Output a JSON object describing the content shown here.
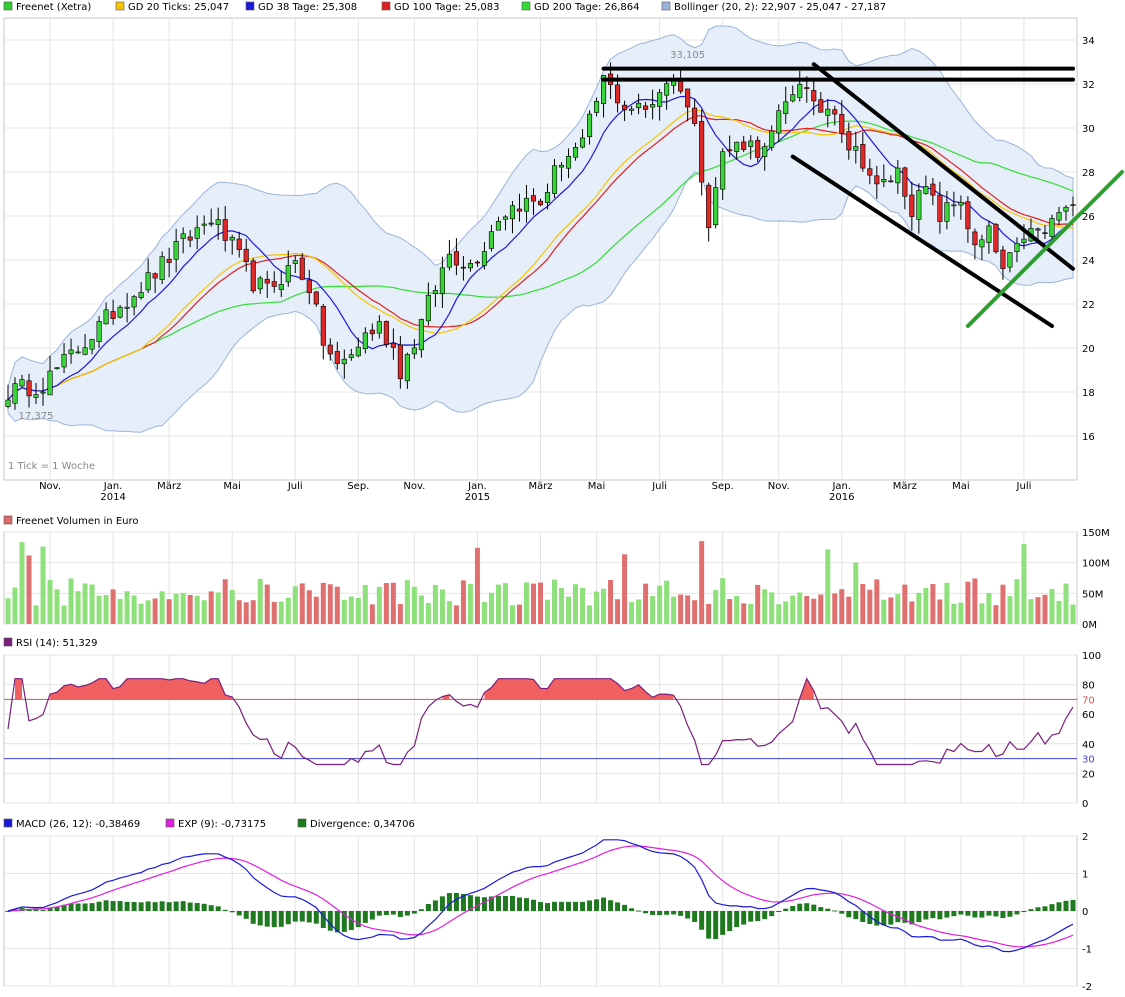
{
  "chart_data": [
    {
      "panel": "price",
      "type": "candlestick",
      "legend": [
        {
          "label": "Freenet (Xetra)",
          "color": "#2ecc2e"
        },
        {
          "label": "GD 20 Ticks: 25,047",
          "color": "#f5c400"
        },
        {
          "label": "GD 38 Tage: 25,308",
          "color": "#1a1adc"
        },
        {
          "label": "GD 100 Tage: 25,083",
          "color": "#e02020"
        },
        {
          "label": "GD 200 Tage: 26,864",
          "color": "#33dd33"
        },
        {
          "label": "Bollinger (20, 2): 22,907 - 25,047 - 27,187",
          "color": "#9ab4dc"
        }
      ],
      "ylim": [
        14,
        35
      ],
      "yticks": [
        "16",
        "18",
        "20",
        "22",
        "24",
        "26",
        "28",
        "30",
        "32",
        "34"
      ],
      "xticks": [
        {
          "label": "Nov.",
          "week": 6
        },
        {
          "label": "Jan.",
          "sub": "2014",
          "week": 15
        },
        {
          "label": "März",
          "week": 23
        },
        {
          "label": "Mai",
          "week": 32
        },
        {
          "label": "Juli",
          "week": 41
        },
        {
          "label": "Sep.",
          "week": 50
        },
        {
          "label": "Nov.",
          "week": 58
        },
        {
          "label": "Jan.",
          "sub": "2015",
          "week": 67
        },
        {
          "label": "März",
          "week": 76
        },
        {
          "label": "Mai",
          "week": 84
        },
        {
          "label": "Juli",
          "week": 93
        },
        {
          "label": "Sep.",
          "week": 102
        },
        {
          "label": "Nov.",
          "week": 110
        },
        {
          "label": "Jan.",
          "sub": "2016",
          "week": 119
        },
        {
          "label": "März",
          "week": 128
        },
        {
          "label": "Mai",
          "week": 136
        },
        {
          "label": "Juli",
          "week": 145
        }
      ],
      "annotations": [
        {
          "text": "33,105",
          "week": 97,
          "value": 33.1
        },
        {
          "text": "17,375",
          "week": 4,
          "value": 17.4
        },
        {
          "text": "1 Tick = 1 Woche"
        }
      ],
      "weeks": 152,
      "close_anchors": [
        [
          0,
          18.0
        ],
        [
          5,
          18.4
        ],
        [
          12,
          20.6
        ],
        [
          16,
          22.0
        ],
        [
          20,
          23.1
        ],
        [
          25,
          24.8
        ],
        [
          29,
          25.9
        ],
        [
          32,
          24.6
        ],
        [
          35,
          23.0
        ],
        [
          37,
          22.6
        ],
        [
          41,
          23.9
        ],
        [
          43,
          22.8
        ],
        [
          45,
          20.3
        ],
        [
          47,
          19.1
        ],
        [
          49,
          19.7
        ],
        [
          51,
          20.6
        ],
        [
          53,
          21.0
        ],
        [
          55,
          20.0
        ],
        [
          56,
          19.0
        ],
        [
          58,
          20.3
        ],
        [
          60,
          22.0
        ],
        [
          63,
          24.3
        ],
        [
          66,
          23.8
        ],
        [
          68,
          24.7
        ],
        [
          70,
          26.0
        ],
        [
          73,
          26.6
        ],
        [
          76,
          26.6
        ],
        [
          79,
          28.6
        ],
        [
          82,
          29.2
        ],
        [
          85,
          32.2
        ],
        [
          88,
          31.0
        ],
        [
          91,
          30.8
        ],
        [
          94,
          32.2
        ],
        [
          96,
          32.0
        ],
        [
          98,
          30.0
        ],
        [
          100,
          25.9
        ],
        [
          102,
          28.8
        ],
        [
          105,
          29.4
        ],
        [
          108,
          28.9
        ],
        [
          110,
          30.4
        ],
        [
          113,
          32.3
        ],
        [
          115,
          30.8
        ],
        [
          118,
          31.0
        ],
        [
          120,
          29.2
        ],
        [
          122,
          28.6
        ],
        [
          124,
          27.2
        ],
        [
          127,
          28.0
        ],
        [
          129,
          26.4
        ],
        [
          131,
          27.2
        ],
        [
          133,
          26.0
        ],
        [
          136,
          26.8
        ],
        [
          138,
          24.4
        ],
        [
          140,
          25.2
        ],
        [
          142,
          23.5
        ],
        [
          144,
          24.4
        ],
        [
          145,
          25.2
        ],
        [
          148,
          25.2
        ],
        [
          150,
          26.2
        ],
        [
          152,
          26.2
        ]
      ],
      "trend_lines": [
        {
          "from": [
            85,
            32.7
          ],
          "to": [
            152,
            32.7
          ],
          "color": "#000000"
        },
        {
          "from": [
            85,
            32.2
          ],
          "to": [
            152,
            32.2
          ],
          "color": "#000000"
        },
        {
          "from": [
            115,
            32.9
          ],
          "to": [
            152,
            23.6
          ],
          "color": "#000000"
        },
        {
          "from": [
            112,
            28.7
          ],
          "to": [
            149,
            21.0
          ],
          "color": "#000000"
        },
        {
          "from": [
            137,
            21.0
          ],
          "to": [
            159,
            28.0
          ],
          "color": "#2ca02c"
        }
      ]
    },
    {
      "panel": "volume",
      "type": "bar",
      "legend": [
        {
          "label": "Freenet Volumen in Euro",
          "color": "#e06a6a"
        }
      ],
      "ylim": [
        0,
        150
      ],
      "yticks": [
        "0M",
        "50M",
        "100M",
        "150M"
      ],
      "colors": {
        "up": "#8ee07a",
        "down": "#e07070"
      }
    },
    {
      "panel": "rsi",
      "type": "line",
      "legend": [
        {
          "label": "RSI (14): 51,329",
          "color": "#7a1f7a"
        }
      ],
      "ylim": [
        0,
        100
      ],
      "yticks": [
        "0",
        "20",
        "40",
        "60",
        "80",
        "100"
      ],
      "levels": [
        {
          "value": 70,
          "label": "70",
          "color": "#e05050"
        },
        {
          "value": 30,
          "label": "30",
          "color": "#4040e0"
        }
      ]
    },
    {
      "panel": "macd",
      "type": "line",
      "legend": [
        {
          "label": "MACD (26, 12): -0,38469",
          "color": "#1a1adc"
        },
        {
          "label": "EXP (9): -0,73175",
          "color": "#e020e0"
        },
        {
          "label": "Divergence: 0,34706",
          "color": "#1a7a1a"
        }
      ],
      "ylim": [
        -2,
        2
      ],
      "yticks": [
        "-2",
        "-1",
        "0",
        "1",
        "2"
      ]
    }
  ]
}
